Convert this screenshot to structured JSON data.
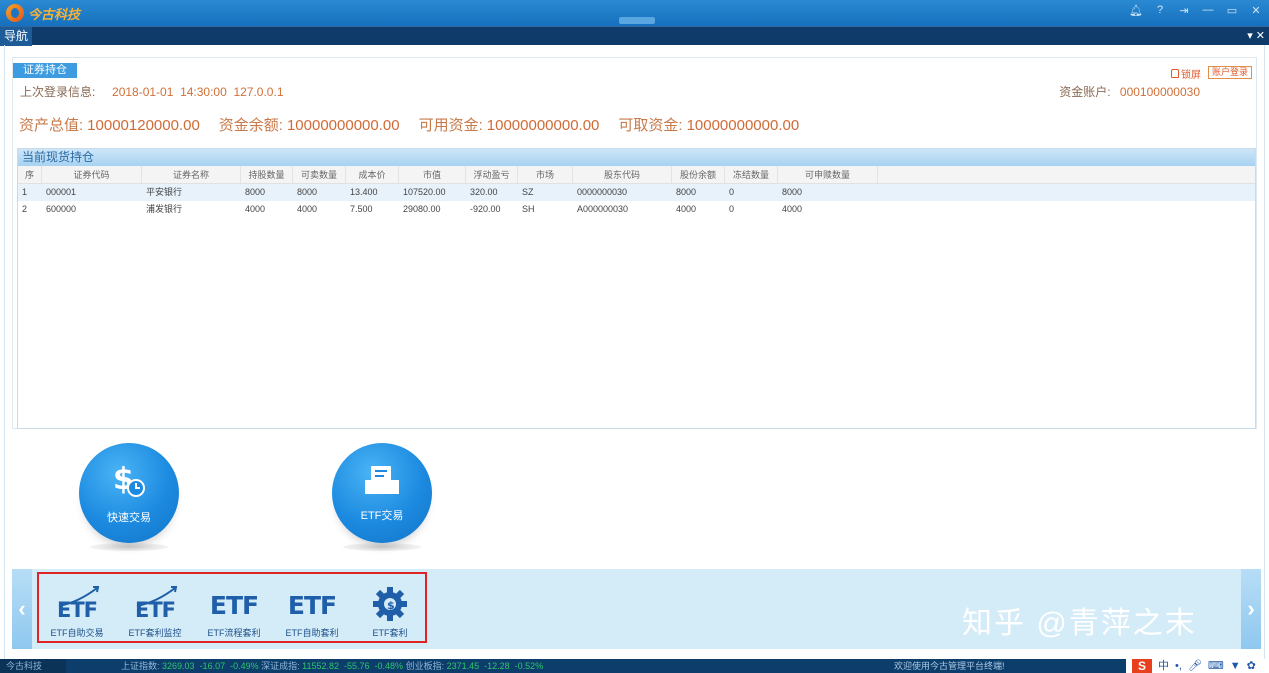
{
  "titlebar": {
    "app_name": "今古科技",
    "controls": [
      "bell-icon",
      "help-icon",
      "pin-icon",
      "minimize-icon",
      "restore-icon",
      "close-icon"
    ]
  },
  "nav": {
    "tab": "导航",
    "right": "▾ ✕"
  },
  "card": {
    "tab": "证券持仓",
    "lock_label": "锁屏",
    "account_login_label": "账户登录",
    "last_login_label": "上次登录信息:",
    "last_login_value": "2018-01-01  14:30:00  127.0.0.1",
    "account_label": "资金账户:",
    "account_value": "000100000030"
  },
  "summary": [
    {
      "label": "资产总值:",
      "value": "10000120000.00"
    },
    {
      "label": "资金余额:",
      "value": "10000000000.00"
    },
    {
      "label": "可用资金:",
      "value": "10000000000.00"
    },
    {
      "label": "可取资金:",
      "value": "10000000000.00"
    }
  ],
  "grid": {
    "title": "当前现货持仓",
    "columns": [
      "序",
      "证券代码",
      "证券名称",
      "持股数量",
      "可卖数量",
      "成本价",
      "市值",
      "浮动盈亏",
      "市场",
      "股东代码",
      "股份余额",
      "冻结数量",
      "可申赎数量"
    ],
    "rows": [
      [
        "1",
        "000001",
        "平安银行",
        "8000",
        "8000",
        "13.400",
        "107520.00",
        "320.00",
        "SZ",
        "0000000030",
        "8000",
        "0",
        "8000"
      ],
      [
        "2",
        "600000",
        "浦发银行",
        "4000",
        "4000",
        "7.500",
        "29080.00",
        "-920.00",
        "SH",
        "A000000030",
        "4000",
        "0",
        "4000"
      ]
    ]
  },
  "big_buttons": [
    {
      "label": "快速交易",
      "icon": "dollar-clock-icon"
    },
    {
      "label": "ETF交易",
      "icon": "document-tray-icon"
    }
  ],
  "tools": [
    {
      "label": "ETF自助交易",
      "logo": "ETF"
    },
    {
      "label": "ETF套利监控",
      "logo": "ETF"
    },
    {
      "label": "ETF流程套利",
      "logo": "ETF"
    },
    {
      "label": "ETF自助套利",
      "logo": "ETF"
    },
    {
      "label": "ETF套利",
      "logo": ""
    }
  ],
  "watermark": "知乎 @青萍之末",
  "status": {
    "company": "今古科技",
    "sh_label": "上证指数:",
    "sh_values": "3269.03  -16.07  -0.49%",
    "sz_label": "深证成指:",
    "sz_values": "11552.82  -55.76  -0.48%",
    "cy_label": "创业板指:",
    "cy_values": "2371.45  -12.28  -0.52%",
    "welcome": "欢迎使用今古管理平台终端!",
    "ime_label": "中"
  },
  "colors": {
    "accent": "#1c8ae0",
    "titlebar": "#1670bd",
    "nav": "#0e3b69",
    "highlight": "#e02424",
    "value_text": "#d06a35"
  }
}
